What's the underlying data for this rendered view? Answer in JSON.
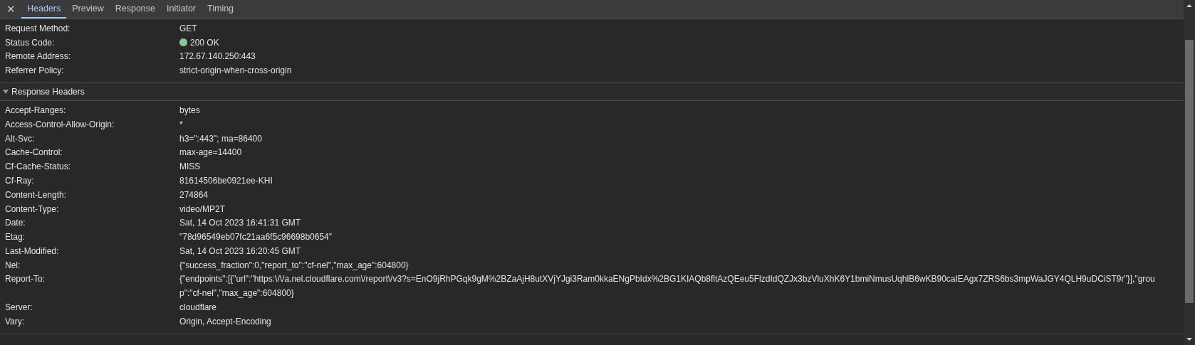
{
  "tabs": [
    {
      "label": "Headers",
      "selected": true
    },
    {
      "label": "Preview",
      "selected": false
    },
    {
      "label": "Response",
      "selected": false
    },
    {
      "label": "Initiator",
      "selected": false
    },
    {
      "label": "Timing",
      "selected": false
    }
  ],
  "close_symbol": "✕",
  "general": [
    {
      "name": "Request Method:",
      "value": "GET"
    },
    {
      "name": "Status Code:",
      "value": "200 OK",
      "color": "#81c995"
    },
    {
      "name": "Remote Address:",
      "value": "172.67.140.250:443"
    },
    {
      "name": "Referrer Policy:",
      "value": "strict-origin-when-cross-origin"
    }
  ],
  "response_headers": {
    "title": "Response Headers",
    "expanded": true,
    "rows": [
      {
        "name": "Accept-Ranges:",
        "value": "bytes"
      },
      {
        "name": "Access-Control-Allow-Origin:",
        "value": "*"
      },
      {
        "name": "Alt-Svc:",
        "value": "h3=\":443\"; ma=86400"
      },
      {
        "name": "Cache-Control:",
        "value": "max-age=14400"
      },
      {
        "name": "Cf-Cache-Status:",
        "value": "MISS"
      },
      {
        "name": "Cf-Ray:",
        "value": "81614506be0921ee-KHI"
      },
      {
        "name": "Content-Length:",
        "value": "274864"
      },
      {
        "name": "Content-Type:",
        "value": "video/MP2T"
      },
      {
        "name": "Date:",
        "value": "Sat, 14 Oct 2023 16:41:31 GMT"
      },
      {
        "name": "Etag:",
        "value": "\"78d96549eb07fc21aa6f5c96698b0654\""
      },
      {
        "name": "Last-Modified:",
        "value": "Sat, 14 Oct 2023 16:20:45 GMT"
      },
      {
        "name": "Nel:",
        "value": "{\"success_fraction\":0,\"report_to\":\"cf-nel\",\"max_age\":604800}"
      },
      {
        "name": "Report-To:",
        "value": "{\"endpoints\":[{\"url\":\"https:\\/\\/a.nel.cloudflare.com\\/report\\/v3?s=EnO9jRhPGqk9gM%2BZaAjH8utXVjYJgi3Ram0kkaENgPbIdx%2BG1KIAQb8fltAzQEeu5FlzdIdQZJx3bzVluXhK6Y1bmiNmusUqhlB6wKB90caIEAgx7ZRS6bs3mpWaJGY4QLH9uDCiST9r\"}],\"group\":\"cf-nel\",\"max_age\":604800}"
      },
      {
        "name": "Server:",
        "value": "cloudflare"
      },
      {
        "name": "Vary:",
        "value": "Origin, Accept-Encoding"
      }
    ]
  }
}
